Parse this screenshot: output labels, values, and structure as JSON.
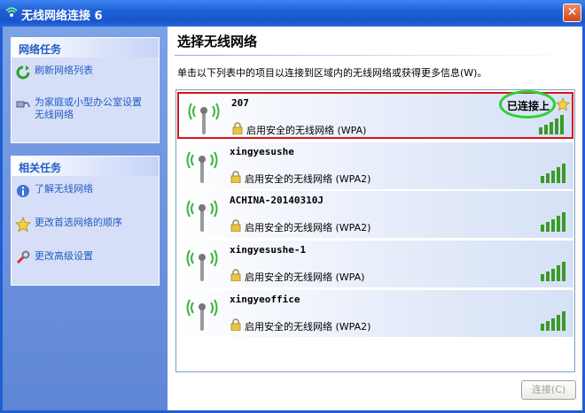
{
  "window": {
    "title": "无线网络连接 6",
    "close_label": "✕"
  },
  "sidebar": {
    "network_tasks": {
      "header": "网络任务",
      "items": [
        {
          "label": "刷新网络列表",
          "icon": "refresh-icon"
        },
        {
          "label": "为家庭或小型办公室设置无线网络",
          "icon": "network-setup-icon"
        }
      ]
    },
    "related_tasks": {
      "header": "相关任务",
      "items": [
        {
          "label": "了解无线网络",
          "icon": "info-icon"
        },
        {
          "label": "更改首选网络的顺序",
          "icon": "star-icon"
        },
        {
          "label": "更改高级设置",
          "icon": "settings-icon"
        }
      ]
    }
  },
  "main": {
    "title": "选择无线网络",
    "description": "单击以下列表中的项目以连接到区域内的无线网络或获得更多信息(W)。",
    "networks": [
      {
        "name": "207",
        "security": "启用安全的无线网络 (WPA)",
        "status": "已连接上",
        "selected": true,
        "signal_bars": 5
      },
      {
        "name": "xingyesushe",
        "security": "启用安全的无线网络 (WPA2)",
        "status": "",
        "selected": false,
        "signal_bars": 5
      },
      {
        "name": "ACHINA-20140310J",
        "security": "启用安全的无线网络 (WPA2)",
        "status": "",
        "selected": false,
        "signal_bars": 5
      },
      {
        "name": "xingyesushe-1",
        "security": "启用安全的无线网络 (WPA)",
        "status": "",
        "selected": false,
        "signal_bars": 5
      },
      {
        "name": "xingyeoffice",
        "security": "启用安全的无线网络 (WPA2)",
        "status": "",
        "selected": false,
        "signal_bars": 5
      }
    ],
    "connect_button": "连接(C)"
  },
  "colors": {
    "titlebar": "#1f5fd6",
    "sidebar": "#6b91dc",
    "link": "#215dc6",
    "selected_border": "#d9141a",
    "connected_ring": "#2cd132",
    "signal": "#3a9a2a"
  }
}
